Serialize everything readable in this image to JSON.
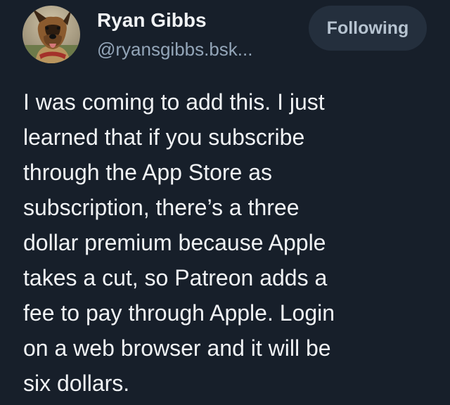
{
  "author": {
    "name": "Ryan Gibbs",
    "handle": "@ryansgibbs.bsk...",
    "avatar_icon": "dog-portrait-avatar"
  },
  "follow_button": {
    "label": "Following"
  },
  "post": {
    "lines": [
      "I was coming to add this. I just",
      "learned that if you subscribe",
      "through the App Store as",
      "subscription, there’s a three",
      "dollar premium because Apple",
      "takes a cut, so Patreon adds a",
      "fee to pay through Apple. Login",
      "on a web browser and it will be",
      "six dollars."
    ]
  },
  "colors": {
    "background": "#171f2a",
    "text": "#f1f3f5",
    "handle": "#93a5b8",
    "button_bg": "#242f3d",
    "button_text": "#b6c3d0"
  }
}
